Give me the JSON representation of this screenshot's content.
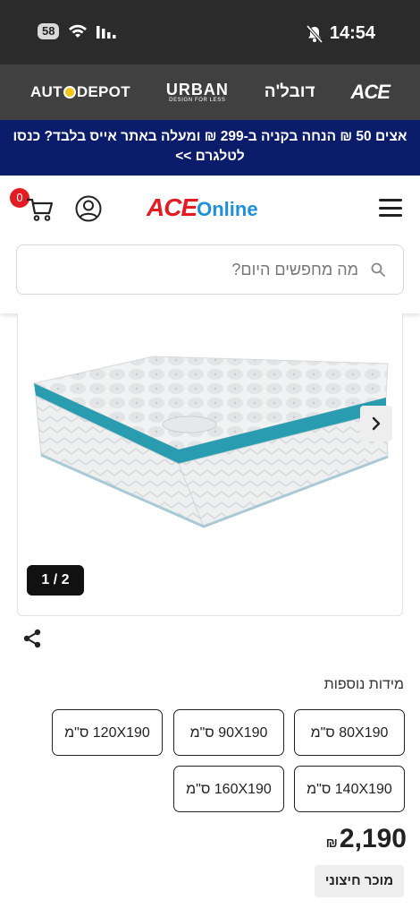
{
  "status_bar": {
    "battery": "58",
    "time": "14:54"
  },
  "brands": {
    "autodepot_left": "AUT",
    "autodepot_right": "DEPOT",
    "urban_main": "URBAN",
    "urban_sub": "DESIGN FOR LESS",
    "dubale": "דובל'ה",
    "ace": "ACE"
  },
  "promo": {
    "text": "אצים 50 ₪ הנחה בקניה ב-299 ₪ ומעלה באתר אייס בלבד? כנסו לטלגרם >>"
  },
  "header": {
    "logo_ace": "ACE",
    "logo_online": "Online",
    "cart_count": "0"
  },
  "search": {
    "placeholder": "מה מחפשים היום?"
  },
  "gallery": {
    "counter": "1 / 2"
  },
  "sizes": {
    "label": "מידות נוספות",
    "options": [
      "80X190 ס\"מ",
      "90X190 ס\"מ",
      "120X190 ס\"מ",
      "140X190 ס\"מ",
      "160X190 ס\"מ"
    ]
  },
  "product": {
    "price": "2,190",
    "currency": "₪",
    "seller": "מוכר חיצוני"
  },
  "colors": {
    "promo_bg": "#0b1c6b",
    "brand_bar": "#404040",
    "accent_red": "#e31b23",
    "accent_blue": "#1f8fd8",
    "mattress_trim": "#2a9cb0"
  }
}
